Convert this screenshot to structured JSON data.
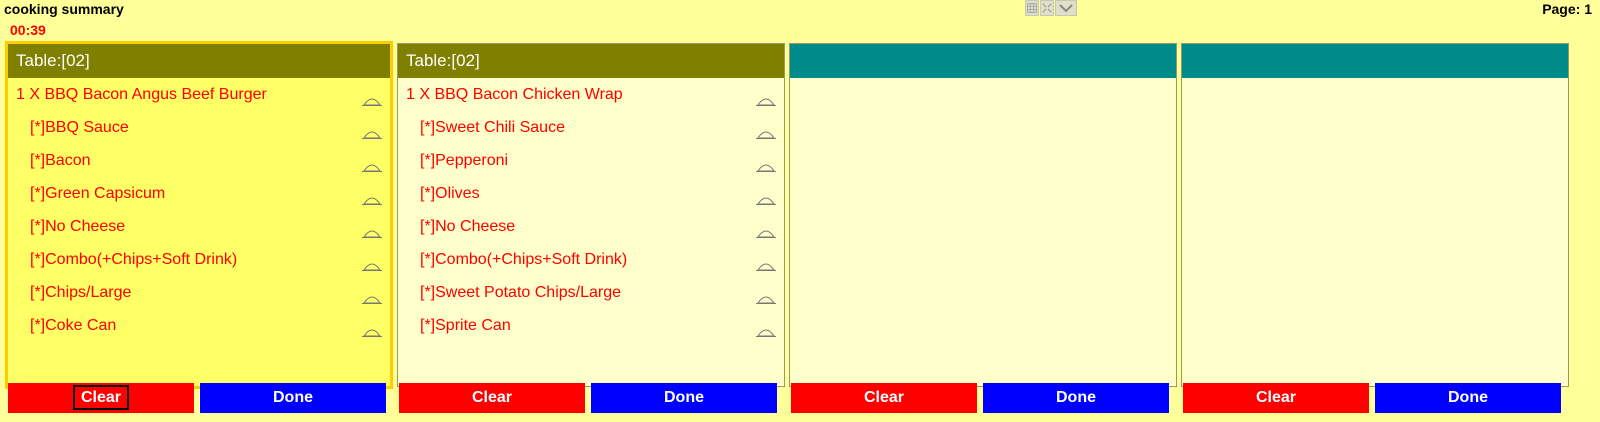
{
  "header": {
    "title": "cooking summary",
    "timer": "00:39",
    "page_label": "Page:  1"
  },
  "toolbar": {
    "icons": [
      "grid-icon",
      "expand-icon",
      "chevron-down-icon"
    ]
  },
  "colors": {
    "background": "#ffff99",
    "selected_panel": "#ffff66",
    "panel": "#ffffcc",
    "header_olive": "#808000",
    "header_teal": "#008b8b",
    "item_text": "#ff0000",
    "clear_button": "#ff0000",
    "done_button": "#0000ff"
  },
  "panels": [
    {
      "header": "Table:[02]",
      "items": [
        {
          "text": "1 X  BBQ Bacon Angus Beef Burger",
          "sub": false
        },
        {
          "text": "[*]BBQ Sauce",
          "sub": true
        },
        {
          "text": "[*]Bacon",
          "sub": true
        },
        {
          "text": "[*]Green Capsicum",
          "sub": true
        },
        {
          "text": "[*]No Cheese",
          "sub": true
        },
        {
          "text": "[*]Combo(+Chips+Soft Drink)",
          "sub": true
        },
        {
          "text": "[*]Chips/Large",
          "sub": true
        },
        {
          "text": "[*]Coke Can",
          "sub": true
        }
      ],
      "clear_label": "Clear",
      "done_label": "Done"
    },
    {
      "header": "Table:[02]",
      "items": [
        {
          "text": "1 X  BBQ Bacon Chicken Wrap",
          "sub": false
        },
        {
          "text": "[*]Sweet Chili Sauce",
          "sub": true
        },
        {
          "text": "[*]Pepperoni",
          "sub": true
        },
        {
          "text": "[*]Olives",
          "sub": true
        },
        {
          "text": "[*]No Cheese",
          "sub": true
        },
        {
          "text": "[*]Combo(+Chips+Soft Drink)",
          "sub": true
        },
        {
          "text": "[*]Sweet Potato Chips/Large",
          "sub": true
        },
        {
          "text": "[*]Sprite Can",
          "sub": true
        }
      ],
      "clear_label": "Clear",
      "done_label": "Done"
    },
    {
      "header": "",
      "items": [],
      "clear_label": "Clear",
      "done_label": "Done"
    },
    {
      "header": "",
      "items": [],
      "clear_label": "Clear",
      "done_label": "Done"
    }
  ]
}
